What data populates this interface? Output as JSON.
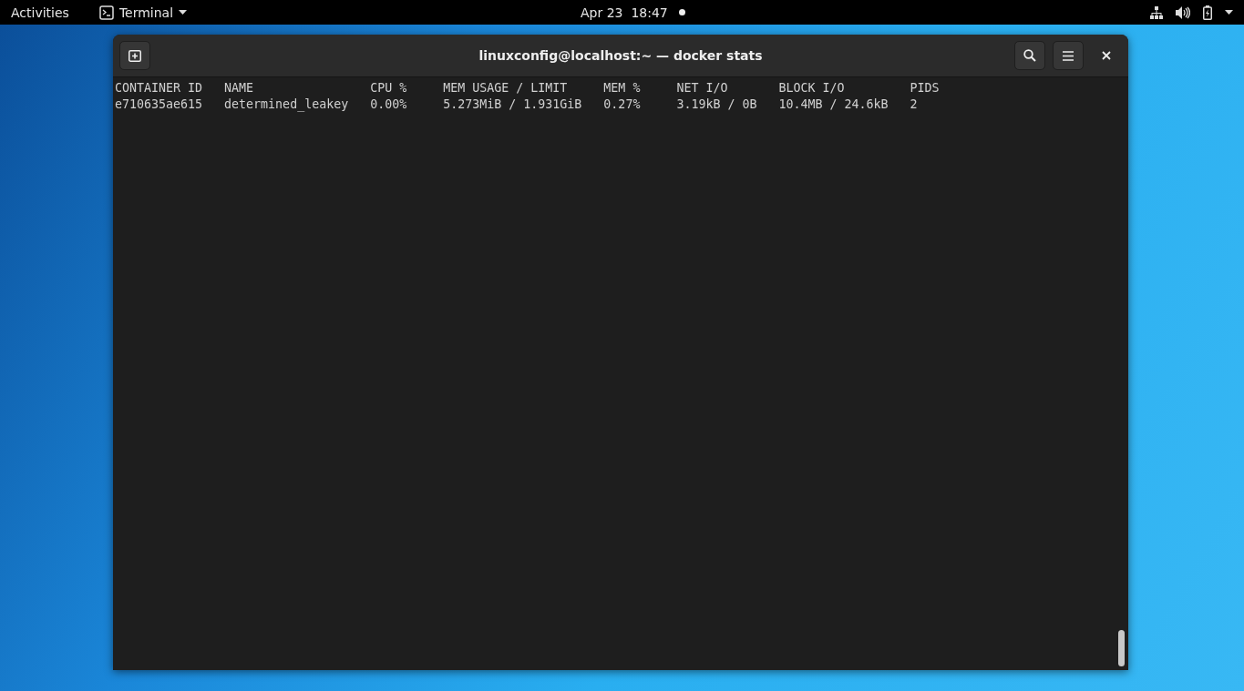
{
  "top_bar": {
    "activities": "Activities",
    "app_menu": "Terminal",
    "clock": "Apr 23  18:47",
    "notification_dot": true
  },
  "window": {
    "title": "linuxconfig@localhost:~ — docker stats"
  },
  "terminal": {
    "lines": [
      "CONTAINER ID   NAME                CPU %     MEM USAGE / LIMIT     MEM %     NET I/O       BLOCK I/O         PIDS",
      "e710635ae615   determined_leakey   0.00%     5.273MiB / 1.931GiB   0.27%     3.19kB / 0B   10.4MB / 24.6kB   2"
    ]
  }
}
